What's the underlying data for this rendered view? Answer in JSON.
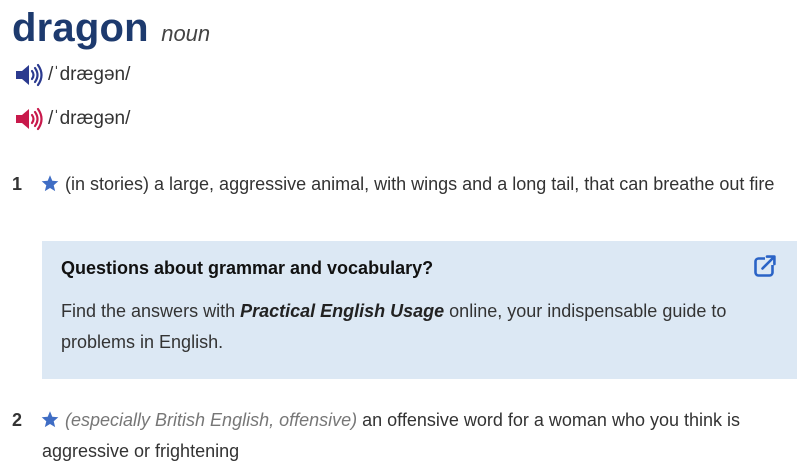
{
  "entry": {
    "headword": "dragon",
    "part_of_speech": "noun"
  },
  "pronunciations": [
    {
      "variant": "uk",
      "icon": "speaker-icon",
      "color": "#2b3a8f",
      "ipa": "/ˈdræɡən/"
    },
    {
      "variant": "us",
      "icon": "speaker-icon",
      "color": "#c8194b",
      "ipa": "/ˈdræɡən/"
    }
  ],
  "senses": [
    {
      "number": "1",
      "icon": "star-icon",
      "labels": "",
      "definition": "(in stories) a large, aggressive animal, with wings and a long tail, that can breathe out fire"
    },
    {
      "number": "2",
      "icon": "star-icon",
      "labels": "(especially British English, offensive)",
      "definition": "an offensive word for a woman who you think is aggressive or frightening"
    }
  ],
  "promo_box": {
    "title": "Questions about grammar and vocabulary?",
    "text_before": "Find the answers with ",
    "reference": "Practical English Usage",
    "text_after": " online, your indispensable guide to problems in English.",
    "icon": "external-link-icon"
  },
  "colors": {
    "headword": "#1d3a6e",
    "star": "#3f6dc4",
    "box_background": "#dce8f4",
    "link_icon": "#2a63c6"
  }
}
